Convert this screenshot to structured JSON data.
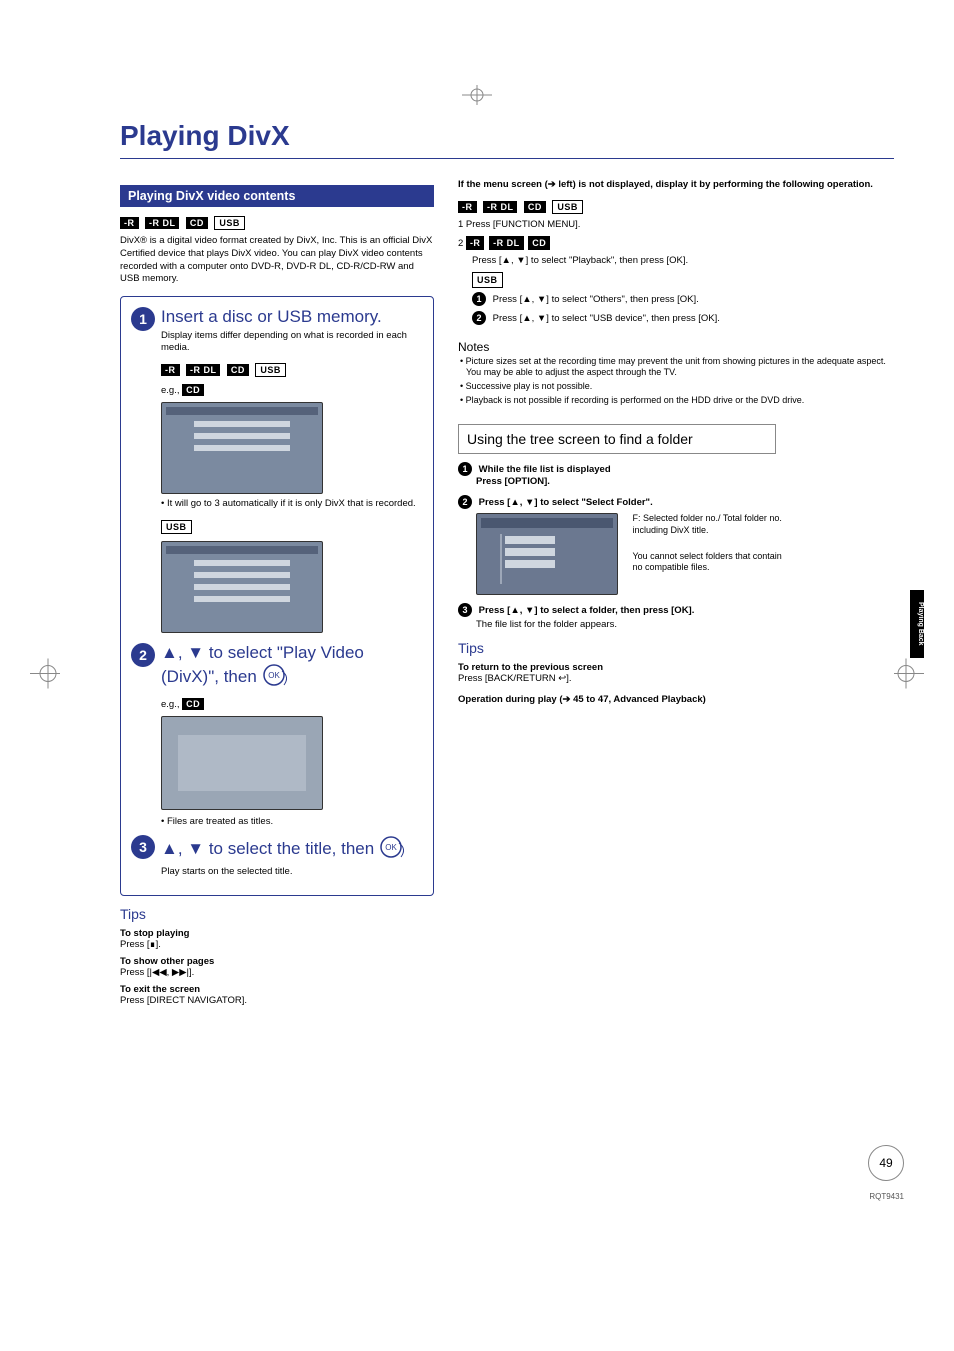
{
  "page_title": "Playing DivX",
  "side_tab": "Playing Back",
  "page_number": "49",
  "doc_code": "RQT9431",
  "left": {
    "section_title": "Playing DivX video contents",
    "tags1": [
      "-R",
      "-R DL",
      "CD",
      "USB"
    ],
    "intro": "DivX® is a digital video format created by DivX, Inc. This is an official DivX Certified device that plays DivX video. You can play DivX video contents recorded with a computer onto DVD-R, DVD-R DL, CD-R/CD-RW and USB memory.",
    "step1_title": "Insert a disc or USB memory.",
    "step1_sub": "Display items differ depending on what is recorded in each media.",
    "step1_tags": [
      "-R",
      "-R DL",
      "CD",
      "USB"
    ],
    "step1_eg": "e.g.,",
    "step1_eg_tag": "CD",
    "step1_note": "• It will go to 3 automatically if it is only DivX that is recorded.",
    "step1_usb_tag": "USB",
    "step2_title_a": "▲, ▼ to select \"Play Video (DivX)\", then",
    "step2_eg": "e.g.,",
    "step2_eg_tag": "CD",
    "step2_note": "• Files are treated as titles.",
    "step3_title": "▲, ▼ to select the title, then",
    "step3_sub": "Play starts on the selected title.",
    "tips_head": "Tips",
    "tip1_b": "To stop playing",
    "tip1": "Press [∎].",
    "tip2_b": "To show other pages",
    "tip2": "Press [|◀◀, ▶▶|].",
    "tip3_b": "To exit the screen",
    "tip3": "Press [DIRECT NAVIGATOR]."
  },
  "right": {
    "intro_b": "If the menu screen (➔ left) is not displayed, display it by performing the following operation.",
    "tags": [
      "-R",
      "-R DL",
      "CD",
      "USB"
    ],
    "line1": "1  Press [FUNCTION MENU].",
    "line2_pre": "2",
    "line2_tags": [
      "-R",
      "-R DL",
      "CD"
    ],
    "line2_body": "Press [▲, ▼] to select \"Playback\", then press [OK].",
    "usb_tag": "USB",
    "usb_step1": "Press [▲, ▼] to select \"Others\", then press [OK].",
    "usb_step2": "Press [▲, ▼] to select \"USB device\", then press [OK].",
    "notes_head": "Notes",
    "note1": "• Picture sizes set at the recording time may prevent the unit from showing pictures in the adequate aspect. You may be able to adjust the aspect through the TV.",
    "note2": "• Successive play is not possible.",
    "note3": "• Playback is not possible if recording is performed on the HDD drive or the DVD drive.",
    "subsection": "Using the tree screen to find a folder",
    "ss1_b": "While the file list is displayed",
    "ss1_b2": "Press [OPTION].",
    "ss2": "Press [▲, ▼] to select \"Select Folder\".",
    "tree_desc1": "F: Selected folder no./ Total folder no. including DivX title.",
    "tree_desc2": "You cannot select folders that contain no compatible files.",
    "ss3_b": "Press [▲, ▼] to select a folder, then press [OK].",
    "ss3": "The file list for the folder appears.",
    "tips_head": "Tips",
    "rtip1_b": "To return to the previous screen",
    "rtip1": "Press [BACK/RETURN ↩].",
    "rtip2_b": "Operation during play (➔ 45 to 47, Advanced Playback)"
  }
}
